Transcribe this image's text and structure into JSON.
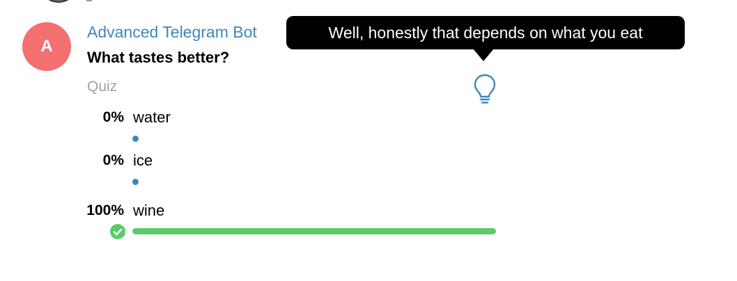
{
  "message": {
    "avatar_letter": "A",
    "sender": "Advanced Telegram Bot",
    "question": "What tastes better?",
    "poll_kind": "Quiz",
    "explanation_tooltip": "Well, honestly that depends on what you eat",
    "explanation_icon": "lightbulb-icon"
  },
  "options": [
    {
      "percent_label": "0%",
      "text": "water",
      "fraction": 0.0,
      "correct": false
    },
    {
      "percent_label": "0%",
      "text": "ice",
      "fraction": 0.0,
      "correct": false
    },
    {
      "percent_label": "100%",
      "text": "wine",
      "fraction": 1.0,
      "correct": true
    }
  ],
  "colors": {
    "avatar_bg": "#f37070",
    "sender": "#3f86bd",
    "tooltip_bg": "#000000",
    "correct": "#5ccb6a",
    "vote_dot": "#3f86bd",
    "muted": "#9aa3ab"
  }
}
